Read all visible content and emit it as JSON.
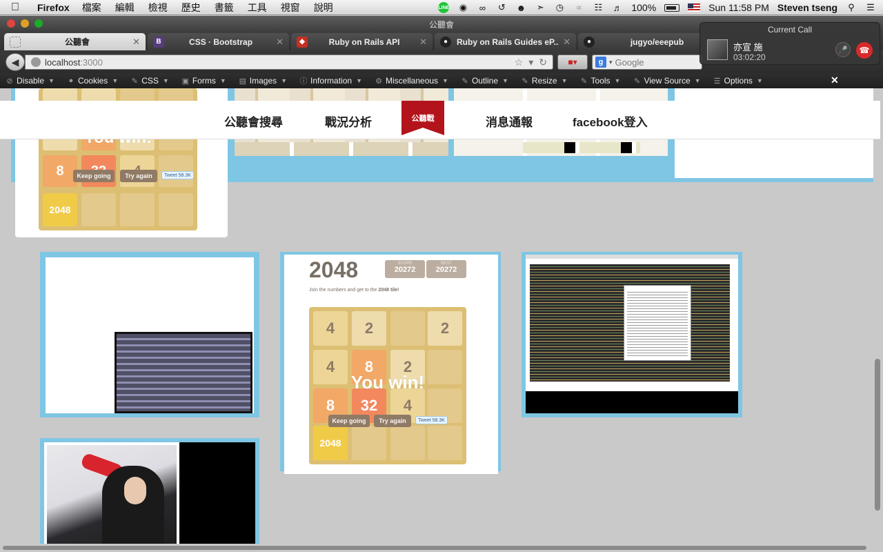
{
  "menubar": {
    "app_name": "Firefox",
    "menus": [
      "檔案",
      "編輯",
      "檢視",
      "歷史",
      "書籤",
      "工具",
      "視窗",
      "說明"
    ],
    "battery": "100%",
    "clock": "Sun 11:58 PM",
    "user": "Steven tseng"
  },
  "window": {
    "title": "公聽會",
    "tabs": [
      {
        "label": "公聽會",
        "active": true
      },
      {
        "label": "CSS · Bootstrap",
        "active": false
      },
      {
        "label": "Ruby on Rails API",
        "active": false
      },
      {
        "label": "Ruby on Rails Guides eP...",
        "active": false
      },
      {
        "label": "jugyo/eeepub",
        "active": false
      }
    ],
    "url_host": "localhost",
    "url_port": ":3000",
    "search_placeholder": "Google"
  },
  "devbar": {
    "items": [
      "Disable",
      "Cookies",
      "CSS",
      "Forms",
      "Images",
      "Information",
      "Miscellaneous",
      "Outline",
      "Resize",
      "Tools",
      "View Source",
      "Options"
    ]
  },
  "call": {
    "title": "Current Call",
    "name": "亦宣 施",
    "duration": "03:02:20"
  },
  "site_nav": {
    "links": [
      "公聽會搜尋",
      "戰況分析",
      "消息通報",
      "facebook登入"
    ],
    "logo_text": "公聽戰"
  },
  "game_small": {
    "win_text": "You win!",
    "keep_going": "Keep going",
    "try_again": "Try again",
    "tweet": "Tweet",
    "tweet_count": "58.3K",
    "tiles": [
      "8",
      "32",
      "4",
      "2048"
    ]
  },
  "game_large": {
    "title": "2048",
    "score_label": "SCORE",
    "score": "20272",
    "best_label": "BEST",
    "best": "20272",
    "intro": "Join the numbers and get to the",
    "intro_bold": "2048 tile!",
    "win_text": "You win!",
    "keep_going": "Keep going",
    "try_again": "Try again",
    "tweet": "Tweet",
    "tweet_count": "58.3K",
    "grid": [
      [
        "4",
        "2",
        "",
        "2"
      ],
      [
        "4",
        "8",
        "2",
        ""
      ],
      [
        "8",
        "32",
        "4",
        ""
      ],
      [
        "2048",
        "",
        "",
        ""
      ]
    ]
  },
  "colors": {
    "card_border": "#7fc6e4",
    "page_bg": "#c9c9c9",
    "logo_red": "#b3141c"
  }
}
